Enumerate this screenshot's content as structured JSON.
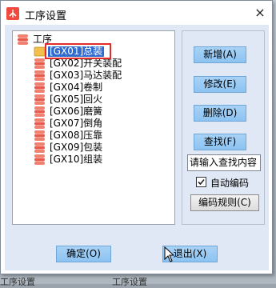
{
  "window": {
    "title": "工序设置",
    "close_label": "×"
  },
  "tree": {
    "root_label": "工序",
    "items": [
      {
        "label": "[GX01]总装",
        "selected": true
      },
      {
        "label": "[GX02]开关装配"
      },
      {
        "label": "[GX03]马达装配"
      },
      {
        "label": "[GX04]卷制"
      },
      {
        "label": "[GX05]回火"
      },
      {
        "label": "[GX06]磨簧"
      },
      {
        "label": "[GX07]倒角"
      },
      {
        "label": "[GX08]压靠"
      },
      {
        "label": "[GX09]包装"
      },
      {
        "label": "[GX10]组装"
      }
    ]
  },
  "actions": {
    "add_label": "新增(A)",
    "edit_label": "修改(E)",
    "delete_label": "删除(D)",
    "find_label": "查找(F)",
    "search_placeholder": "请输入查找内容",
    "auto_code_label": "自动编码",
    "auto_code_checked": true,
    "code_rule_label": "编码规则(C)"
  },
  "footer": {
    "ok_label": "确定(O)",
    "exit_label": "退出(X)"
  },
  "background": {
    "left_text": "工序设置",
    "right_text": "工序设置"
  },
  "colors": {
    "button_blue": "#9ccbf4",
    "selection": "#2f6bd1",
    "highlight_box": "#e32b2b",
    "client_bg": "#dfe8f4"
  }
}
